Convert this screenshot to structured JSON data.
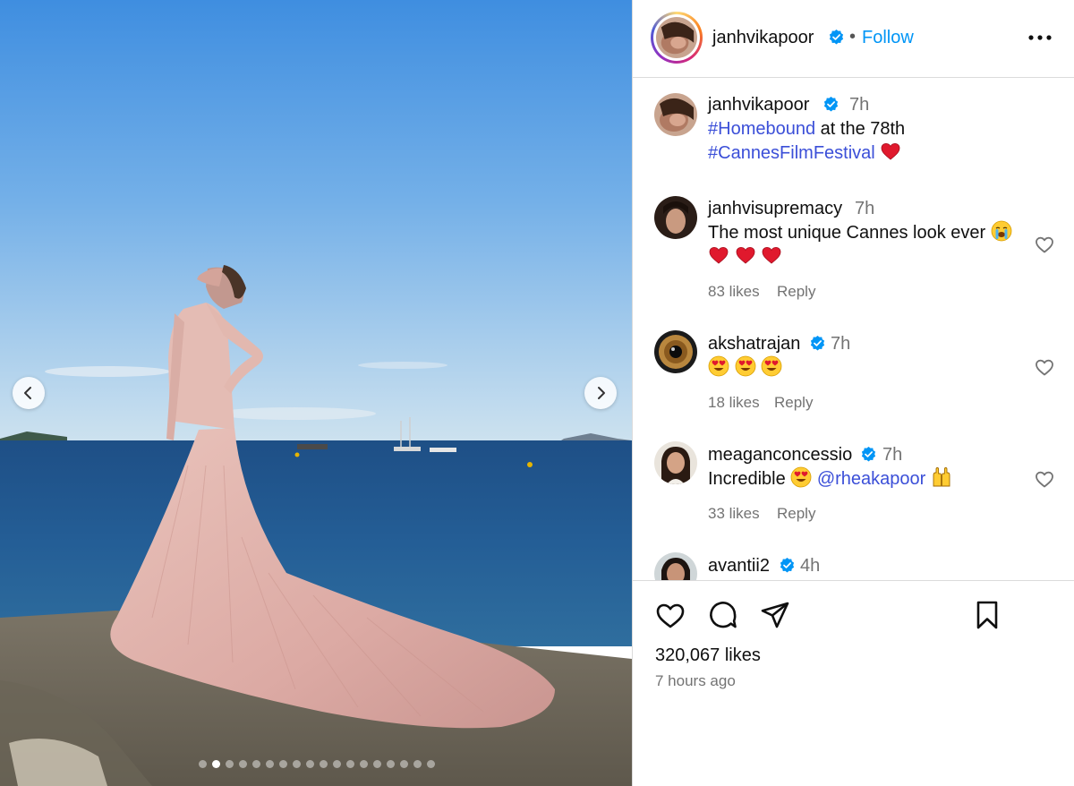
{
  "post": {
    "username": "janhvikapoor",
    "follow_label": "Follow",
    "separator": "•",
    "likes": "320,067 likes",
    "time_ago": "7 hours ago",
    "carousel_total": 18,
    "carousel_active_index": 2
  },
  "caption": {
    "username": "janhvikapoor",
    "time": "7h",
    "hashtag1": "#Homebound",
    "text_mid": " at the 78th",
    "hashtag2": "#CannesFilmFestival"
  },
  "comments": [
    {
      "username": "janhvisupremacy",
      "time": "7h",
      "verified": false,
      "text": "The most unique Cannes look ever",
      "likes": "83 likes",
      "reply": "Reply"
    },
    {
      "username": "akshatrajan",
      "time": "7h",
      "verified": true,
      "text": "",
      "likes": "18 likes",
      "reply": "Reply"
    },
    {
      "username": "meaganconcessio",
      "time": "7h",
      "verified": true,
      "text": "Incredible",
      "mention": "@rheakapoor",
      "likes": "33 likes",
      "reply": "Reply"
    },
    {
      "username": "avantii2",
      "time": "4h",
      "verified": true
    }
  ],
  "icons": {
    "heart": "heart-icon",
    "comment": "comment-icon",
    "share": "share-icon",
    "save": "bookmark-icon",
    "more": "more-options-icon",
    "verified": "verified-badge-icon",
    "prev": "chevron-left-icon",
    "next": "chevron-right-icon"
  },
  "colors": {
    "link": "#0095f6",
    "hashtag": "#3b4fd8",
    "verified": "#0095f6",
    "muted": "#737373",
    "divider": "#dbdbdb"
  }
}
